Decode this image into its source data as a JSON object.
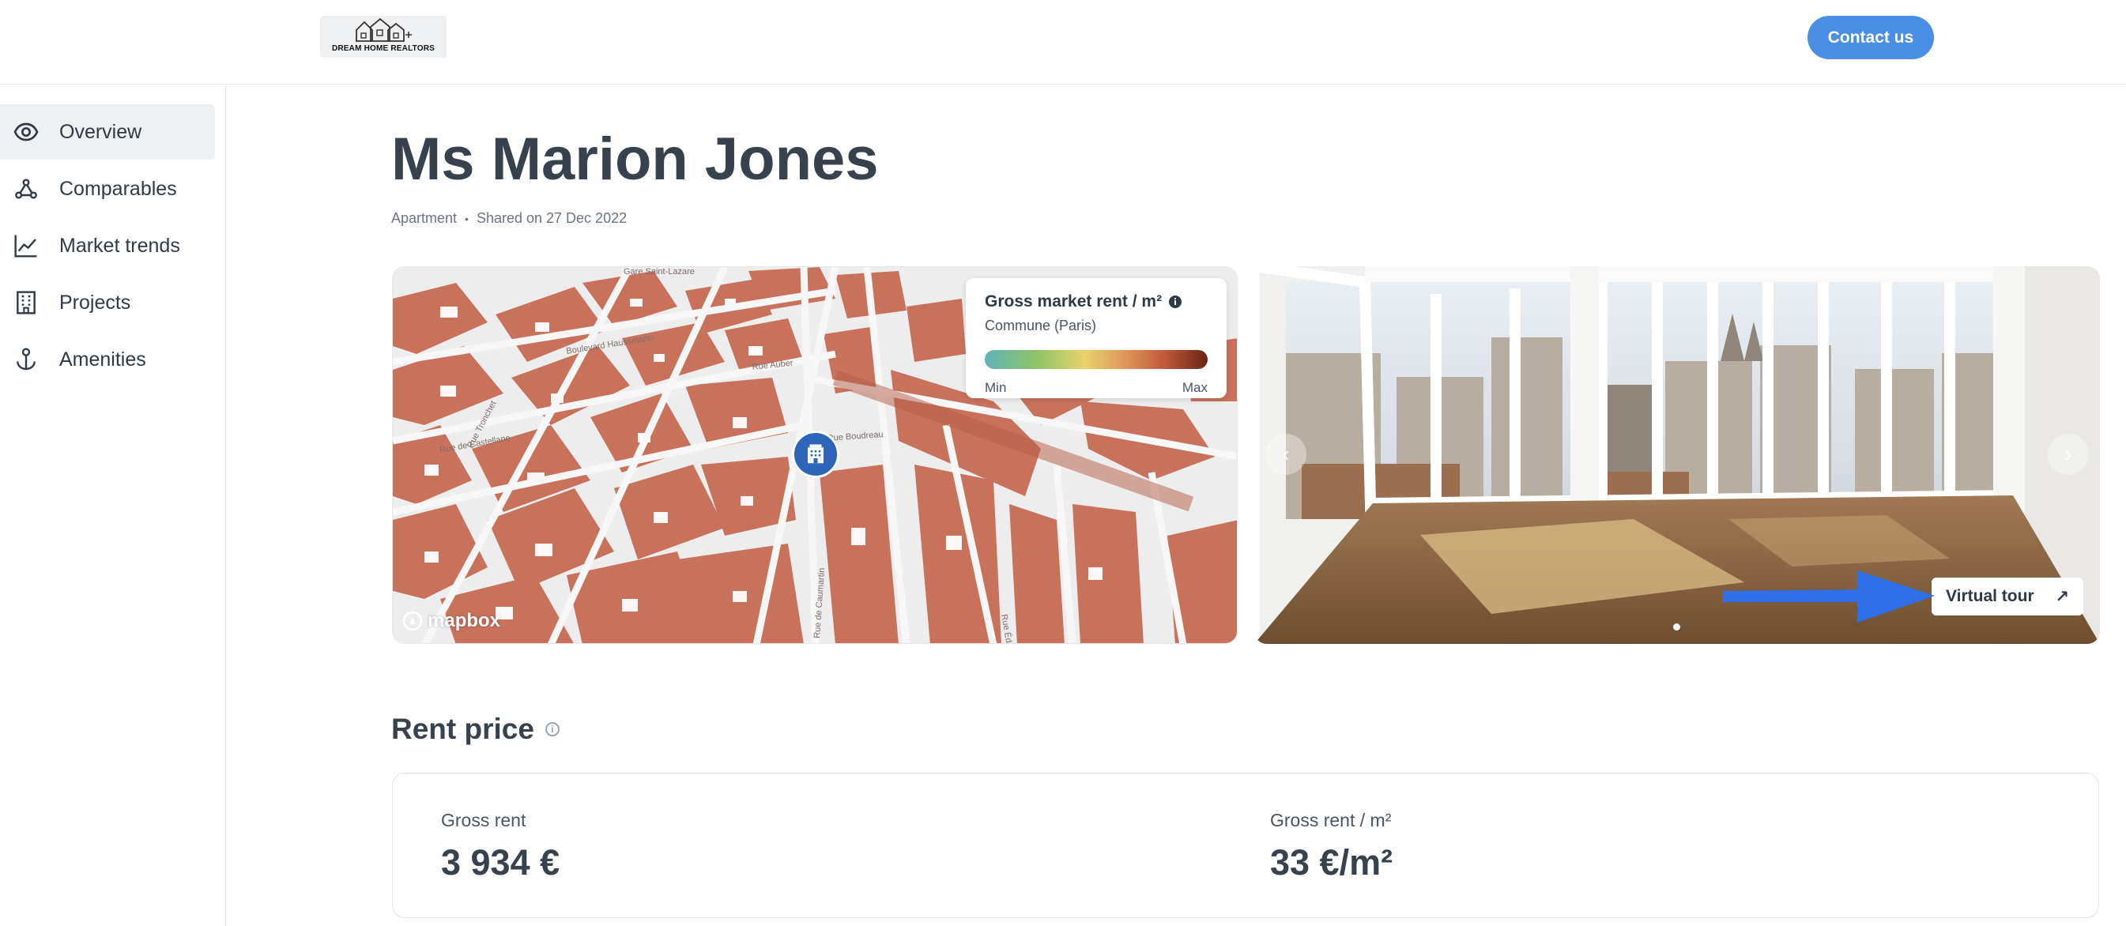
{
  "header": {
    "logo_text": "DREAM HOME REALTORS",
    "contact_label": "Contact us"
  },
  "sidebar": {
    "items": [
      {
        "label": "Overview",
        "icon": "eye-icon",
        "active": true
      },
      {
        "label": "Comparables",
        "icon": "network-icon",
        "active": false
      },
      {
        "label": "Market trends",
        "icon": "line-chart-icon",
        "active": false
      },
      {
        "label": "Projects",
        "icon": "building-icon",
        "active": false
      },
      {
        "label": "Amenities",
        "icon": "anchor-icon",
        "active": false
      }
    ]
  },
  "main": {
    "title": "Ms Marion Jones",
    "property_type": "Apartment",
    "shared": "Shared on 27 Dec 2022"
  },
  "map": {
    "legend_title": "Gross market rent / m²",
    "legend_subtitle": "Commune (Paris)",
    "legend_min": "Min",
    "legend_max": "Max",
    "attribution": "mapbox",
    "street_labels": [
      "Gare Saint-Lazare",
      "Rue Tronchet",
      "Rue de Castellane",
      "Rue de Caumartin",
      "Rue Édouard",
      "Boulevard Haussmann",
      "Rue Auber",
      "Rue Boudreau"
    ]
  },
  "photo": {
    "virtual_tour_label": "Virtual tour",
    "arrow_symbol": "↗",
    "prev_symbol": "‹",
    "next_symbol": "›"
  },
  "rent": {
    "section_title": "Rent price",
    "gross_rent_label": "Gross rent",
    "gross_rent_value": "3 934 €",
    "gross_rent_m2_label": "Gross rent / m²",
    "gross_rent_m2_value": "33 €/m²"
  },
  "colors": {
    "accent": "#4a8ee6",
    "building": "#c8725c",
    "pin": "#2d66b8",
    "arrow": "#2f6fe8"
  }
}
